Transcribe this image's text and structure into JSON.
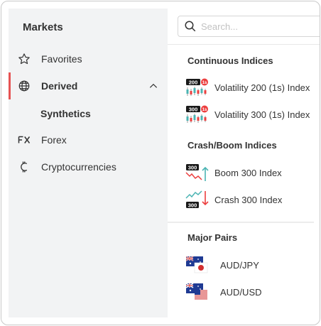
{
  "sidebar": {
    "title": "Markets",
    "items": [
      {
        "label": "Favorites",
        "icon": "star-icon"
      },
      {
        "label": "Derived",
        "icon": "globe-icon",
        "active": true
      },
      {
        "label": "Forex",
        "icon": "fx-icon"
      },
      {
        "label": "Cryptocurrencies",
        "icon": "crypto-icon"
      }
    ],
    "sub_item": "Synthetics"
  },
  "search": {
    "placeholder": "Search..."
  },
  "sections": [
    {
      "title": "Continuous Indices",
      "items": [
        {
          "label": "Volatility 200 (1s) Index",
          "badge": "200",
          "tag": "1s"
        },
        {
          "label": "Volatility 300 (1s) Index",
          "badge": "300",
          "tag": "1s"
        }
      ]
    },
    {
      "title": "Crash/Boom Indices",
      "items": [
        {
          "label": "Boom 300 Index",
          "badge": "300"
        },
        {
          "label": "Crash 300 Index",
          "badge": "300"
        }
      ]
    },
    {
      "title": "Major Pairs",
      "items": [
        {
          "label": "AUD/JPY"
        },
        {
          "label": "AUD/USD"
        }
      ]
    }
  ],
  "colors": {
    "accent": "#e65353",
    "sidebar_bg": "#f2f3f4",
    "green": "#4bb4b3",
    "red": "#ec3f3f"
  }
}
